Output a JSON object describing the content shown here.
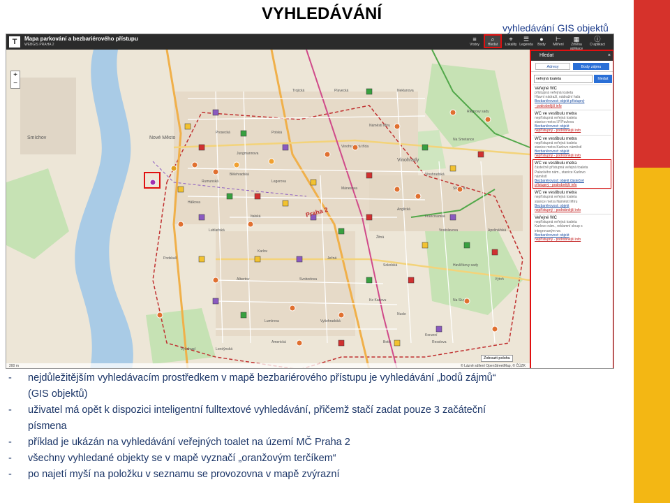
{
  "slide": {
    "title": "VYHLEDÁVÁNÍ",
    "subtitle": "vyhledávání GIS objektů"
  },
  "colors": {
    "accent_red": "#e01010",
    "deco_red": "#d6322b",
    "deco_yellow": "#f3b714",
    "text_blue": "#1b3567",
    "app_bar": "#2b2b2b"
  },
  "app": {
    "title": "Mapa parkování a bezbariérového přístupu",
    "subtitle": "WEBGIS PRAHA 2",
    "tools": [
      {
        "label": "Vrstvy",
        "icon": "layers-icon"
      },
      {
        "label": "Hledat",
        "icon": "search-icon"
      },
      {
        "label": "Lokality",
        "icon": "pin-icon"
      },
      {
        "label": "Legenda",
        "icon": "list-icon"
      },
      {
        "label": "Body",
        "icon": "point-icon"
      },
      {
        "label": "Měření",
        "icon": "ruler-icon"
      },
      {
        "label": "Změna aplikace",
        "icon": "grid-icon"
      },
      {
        "label": "O aplikaci",
        "icon": "info-icon"
      }
    ]
  },
  "map": {
    "labels": [
      "Smíchov",
      "Nové Město",
      "Praha 2",
      "Vinohrady",
      "Nusle",
      "Vyšehrad",
      "Albertov",
      "Podskalí",
      "Karlov",
      "Havlíčkovy sady",
      "Riegrovy sady",
      "Náměstí Míru",
      "Jungmannova",
      "Vinohradská",
      "Legerova",
      "Sokolská",
      "Vyšehradská",
      "Mánesova",
      "Slezská",
      "Francouzská",
      "Na Smetance",
      "Americká",
      "Londýnská",
      "Rumunská",
      "Bělehradská",
      "Lublaňská",
      "Žitná",
      "Ječná",
      "Resslova",
      "Trojická",
      "Plavecká",
      "Výtoň",
      "Na Slupi",
      "Apolinářská",
      "Ke Karlovu",
      "Botič",
      "Svobodova",
      "Lumírova",
      "Vratislavova",
      "Neklanova",
      "Prosecká",
      "Hálkova",
      "Vinohradská třída",
      "Italská",
      "Anglická",
      "Polská",
      "Korunní"
    ],
    "zoom_in": "+",
    "zoom_out": "−",
    "scale": "200 m",
    "attribution": "© Lázně sdílení OpenStreetMap, © ČÚZK",
    "locate_button": "Zobrazit polohu"
  },
  "panel": {
    "header": "Hledat",
    "close": "×",
    "tabs": [
      "Adresy",
      "Body zájmu"
    ],
    "search_value": "veřejná toaleta",
    "search_button": "hledat",
    "results": [
      {
        "title": "Veřejné WC",
        "lines": [
          "přístupná veřejná toaleta",
          "Hlavní nádraží, nádražní hala"
        ],
        "links": [
          "Bezbariérovost: objekt přístupný",
          "- podrobnější info"
        ],
        "highlight": false
      },
      {
        "title": "WC ve vestibulu metra",
        "lines": [
          "nepřístupná veřejná toaleta",
          "stanice metra I.P.Pavlova"
        ],
        "links": [
          "Bezbariérovost: objekt",
          "nepřístupný - podrobnější info"
        ],
        "highlight": false
      },
      {
        "title": "WC ve vestibulu metra",
        "lines": [
          "nepřístupná veřejná toaleta",
          "stanice metra Karlovo náměstí"
        ],
        "links": [
          "Bezbariérovost: objekt",
          "nepřístupný - podrobnější info"
        ],
        "highlight": false
      },
      {
        "title": "WC ve vestibulu metra",
        "lines": [
          "částečně přístupná veřejná toaleta",
          "Palackého nám., stanice Karlovo",
          "náměstí"
        ],
        "links": [
          "Bezbariérovost: objekt částečně",
          "přístupný - podrobnější info"
        ],
        "highlight": true
      },
      {
        "title": "WC ve vestibulu metra",
        "lines": [
          "nepřístupná veřejná toaleta",
          "stanice metra Náměstí Míru"
        ],
        "links": [
          "Bezbariérovost: objekt",
          "nepřístupný - podrobnější info"
        ],
        "highlight": false
      },
      {
        "title": "Veřejné WC",
        "lines": [
          "nepřístupná veřejná toaleta",
          "Karlovo nám., reklamní sloup s",
          "integrovaným wc"
        ],
        "links": [
          "Bezbariérovost: objekt",
          "nepřístupný - podrobnější info"
        ],
        "highlight": false
      }
    ]
  },
  "bullets": [
    {
      "dash": "-",
      "text": "nejdůležitějším vyhledávacím prostředkem v mapě bezbariérového přístupu je vyhledávání „bodů zájmů“"
    },
    {
      "dash": "",
      "text": "(GIS objektů)"
    },
    {
      "dash": "-",
      "text": "uživatel má opět k dispozici inteligentní fulltextové vyhledávání, přičemž stačí zadat pouze 3 začáteční"
    },
    {
      "dash": "",
      "text": "písmena"
    },
    {
      "dash": "-",
      "text": "příklad je ukázán na vyhledávání veřejných toalet na území MČ Praha 2"
    },
    {
      "dash": "-",
      "text": "všechny vyhledané objekty se v mapě vyznačí „oranžovým terčíkem“"
    },
    {
      "dash": "-",
      "text": "po najetí myší na položku v seznamu se provozovna v mapě zvýrazní"
    }
  ]
}
